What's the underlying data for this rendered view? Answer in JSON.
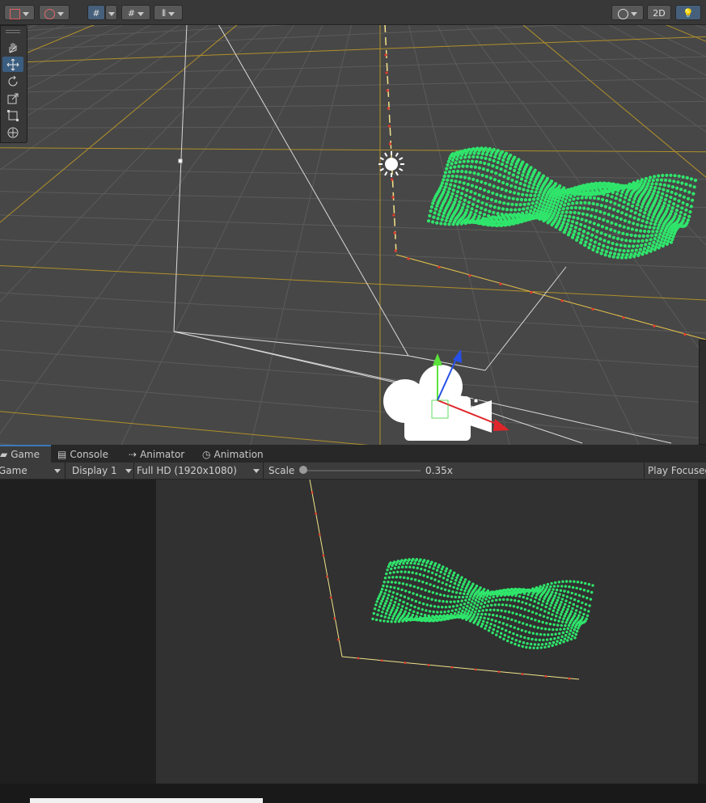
{
  "scene_toolbar": {
    "toggle_2d_label": "2D"
  },
  "tools": [
    "hand-tool",
    "move-tool",
    "rotate-tool",
    "scale-tool",
    "rect-tool",
    "transform-tool"
  ],
  "tabs": [
    {
      "label": "Game",
      "icon": "gamepad-icon",
      "active": true
    },
    {
      "label": "Console",
      "icon": "console-icon",
      "active": false
    },
    {
      "label": "Animator",
      "icon": "animator-icon",
      "active": false
    },
    {
      "label": "Animation",
      "icon": "clock-icon",
      "active": false
    }
  ],
  "game_toolbar": {
    "view_mode": "Game",
    "display": "Display 1",
    "resolution": "Full HD (1920x1080)",
    "scale_label": "Scale",
    "scale_value": "0.35x",
    "scale_fraction": 0.02,
    "play_mode": "Play Focused"
  },
  "colors": {
    "selection_blue": "#46607c",
    "tab_accent": "#3a79bb",
    "terrain_green": "#2fe56b",
    "grid_yellow": "#c9a52a",
    "axis_red": "#e0252a",
    "axis_green": "#3cd63a",
    "axis_blue": "#2750e8"
  }
}
